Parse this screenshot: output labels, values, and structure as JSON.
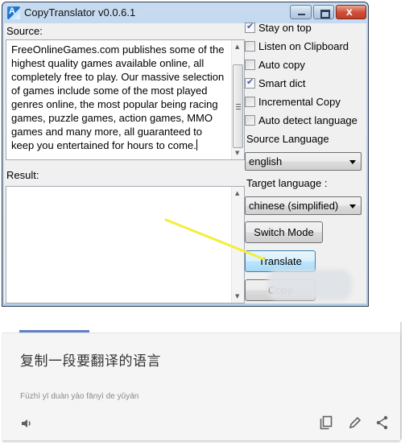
{
  "window": {
    "title": "CopyTranslator v0.0.6.1",
    "controls": [
      "minimize",
      "maximize",
      "close"
    ],
    "close_glyph": "x"
  },
  "source": {
    "label": "Source:",
    "text": "FreeOnlineGames.com publishes some of the\nhighest quality games available online, all\ncompletely free to play. Our massive selection\nof games include some of the most played\ngenres online, the most popular being racing\ngames, puzzle games, action games, MMO\ngames and many more, all guaranteed to\nkeep you entertained for hours to come."
  },
  "result": {
    "label": "Result:",
    "text": ""
  },
  "options": [
    {
      "label": "Stay on top",
      "checked": true
    },
    {
      "label": "Listen on Clipboard",
      "checked": false
    },
    {
      "label": "Auto copy",
      "checked": false
    },
    {
      "label": "Smart dict",
      "checked": true
    },
    {
      "label": "Incremental Copy",
      "checked": false
    },
    {
      "label": "Auto detect language",
      "checked": false
    }
  ],
  "source_language": {
    "label": "Source Language",
    "selected": "english"
  },
  "target_language": {
    "label": "Target language :",
    "selected": "chinese (simplified)"
  },
  "buttons": {
    "switch_mode": "Switch Mode",
    "translate": "Translate",
    "copy": "Copy"
  },
  "app_icon_glyph": "A",
  "translation_card": {
    "translated_text": "复制一段要翻译的语言",
    "romanization": "Fùzhì yī duàn yào fānyì de yǔyán",
    "icons": [
      "speaker-icon",
      "copy-icon",
      "edit-icon",
      "share-icon"
    ]
  },
  "annotation": {
    "arrow_color": "#f2ee3a"
  }
}
